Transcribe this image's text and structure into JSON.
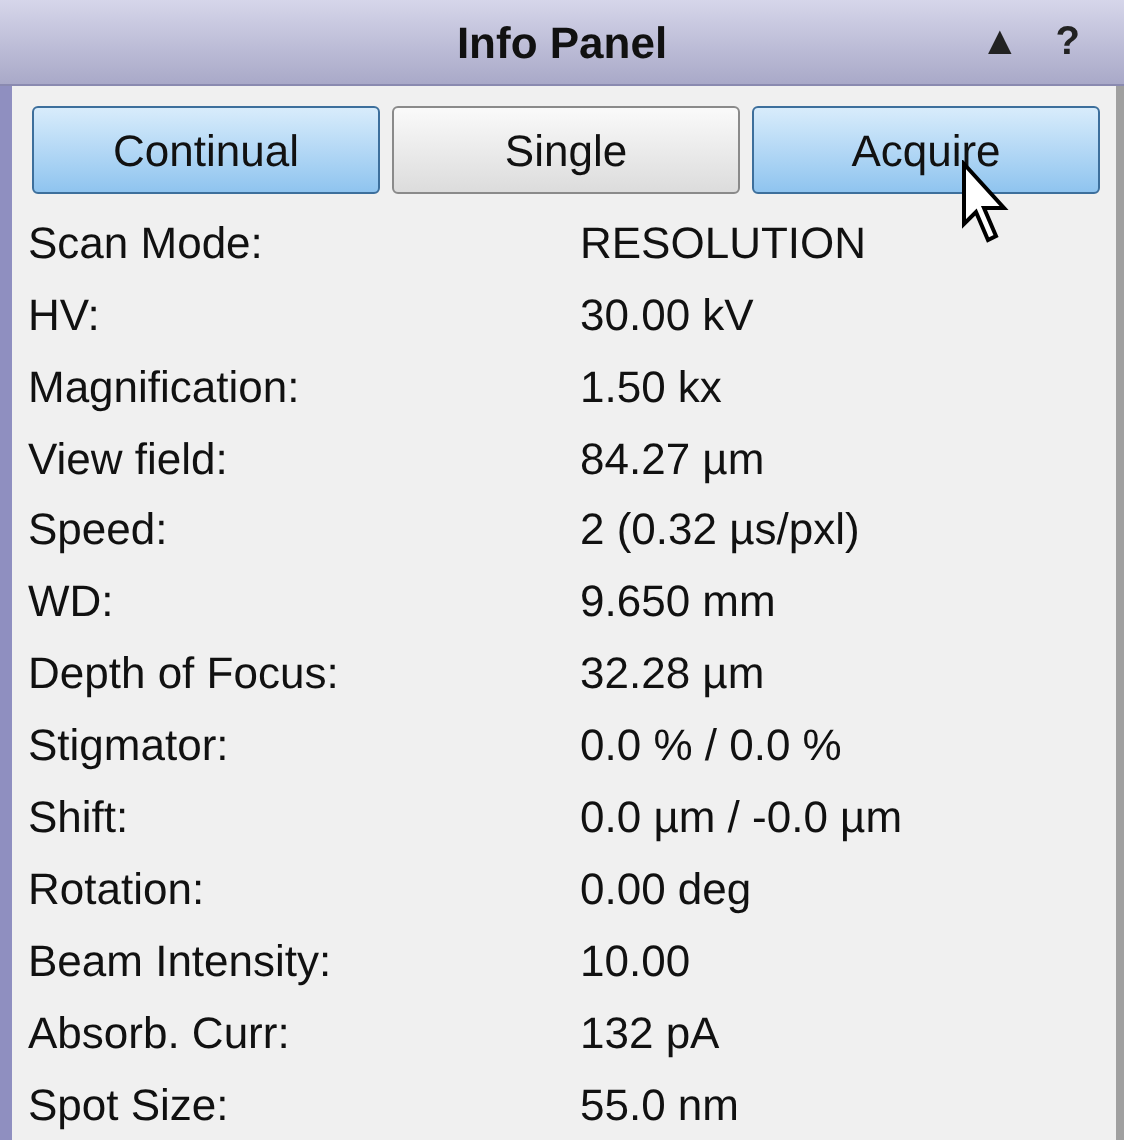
{
  "panel": {
    "title": "Info Panel",
    "controls": [
      "▲",
      "?"
    ]
  },
  "buttons": [
    {
      "label": "Continual",
      "highlighted": true
    },
    {
      "label": "Single",
      "highlighted": false
    },
    {
      "label": "Acquire",
      "highlighted": true
    }
  ],
  "rows": [
    {
      "label": "Scan Mode:",
      "value": "RESOLUTION"
    },
    {
      "label": "HV:",
      "value": "30.00 kV"
    },
    {
      "label": "Magnification:",
      "value": "1.50 kx"
    },
    {
      "label": "View field:",
      "value": "84.27 µm"
    },
    {
      "label": "Speed:",
      "value": "2 (0.32 µs/pxl)"
    },
    {
      "label": "WD:",
      "value": "9.650 mm"
    },
    {
      "label": "Depth of Focus:",
      "value": "32.28 µm"
    },
    {
      "label": "Stigmator:",
      "value": "0.0 % / 0.0 %"
    },
    {
      "label": "Shift:",
      "value": "0.0 µm / -0.0 µm"
    },
    {
      "label": "Rotation:",
      "value": "0.00 deg"
    },
    {
      "label": "Beam Intensity:",
      "value": "10.00"
    },
    {
      "label": "Absorb. Curr:",
      "value": "132 pA"
    },
    {
      "label": "Spot Size:",
      "value": "55.0 nm"
    }
  ]
}
